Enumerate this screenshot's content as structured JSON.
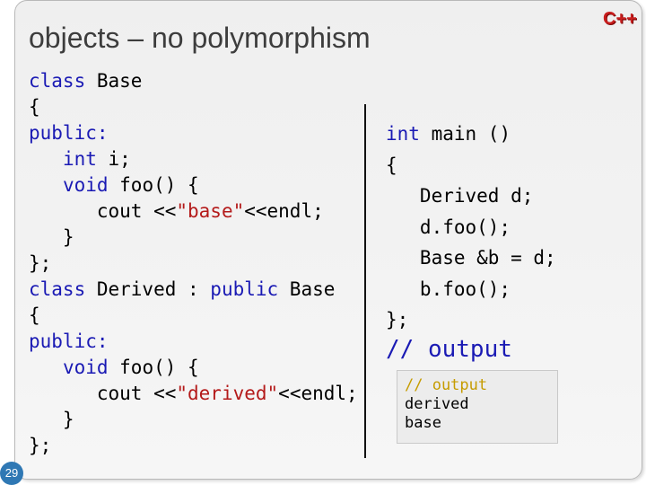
{
  "slide": {
    "title": "objects – no polymorphism",
    "logo": "C++",
    "page_number": "29"
  },
  "left_code": [
    "class Base",
    "{",
    "public:",
    "   int i;",
    "   void foo() {",
    "      cout <<\"base\"<<endl;",
    "   }",
    "};",
    "class Derived : public Base",
    "{",
    "public:",
    "   void foo() {",
    "      cout <<\"derived\"<<endl;",
    "   }",
    "};"
  ],
  "right_code": [
    "int main ()",
    "{",
    "   Derived d;",
    "   d.foo();",
    "   Base &b = d;",
    "   b.foo();",
    "};"
  ],
  "output_comment": "// output",
  "output_box": {
    "comment": "// output",
    "lines": [
      "derived",
      "base"
    ]
  }
}
